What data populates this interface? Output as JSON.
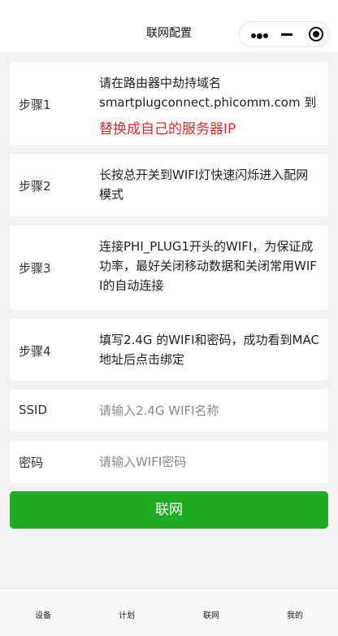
{
  "navbar": {
    "title": "联网配置"
  },
  "steps": [
    {
      "label": "步骤1",
      "lines": [
        "请在路由器中劫持域名",
        "smartplugconnect.phicomm.com 到"
      ],
      "highlight": "替换成自己的服务器IP"
    },
    {
      "label": "步骤2",
      "text": "长按总开关到WIFI灯快速闪烁进入配网模式"
    },
    {
      "label": "步骤3",
      "text": "连接PHI_PLUG1开头的WIFI，为保证成功率，最好关闭移动数据和关闭常用WIFI的自动连接"
    },
    {
      "label": "步骤4",
      "text": "填写2.4G 的WIFI和密码，成功看到MAC地址后点击绑定"
    }
  ],
  "form": {
    "ssid_label": "SSID",
    "ssid_placeholder": "请输入2.4G WIFI名称",
    "ssid_value": "",
    "password_label": "密码",
    "password_placeholder": "请输入WIFI密码",
    "password_value": ""
  },
  "submit_label": "联网",
  "tabbar": [
    "设备",
    "计划",
    "联网",
    "我的"
  ],
  "colors": {
    "primary": "#20ad26",
    "highlight": "#e02b2b",
    "background": "#f2f2f2"
  }
}
